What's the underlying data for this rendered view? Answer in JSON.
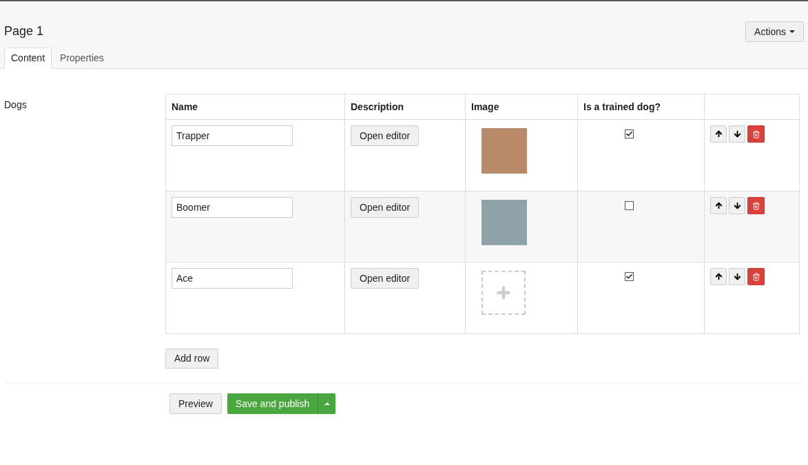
{
  "page": {
    "title": "Page 1",
    "actions_button": "Actions"
  },
  "tabs": [
    {
      "label": "Content",
      "selected": true
    },
    {
      "label": "Properties",
      "selected": false
    }
  ],
  "field": {
    "label": "Dogs"
  },
  "table": {
    "columns": [
      "Name",
      "Description",
      "Image",
      "Is a trained dog?"
    ],
    "rows": [
      {
        "name": "Trapper",
        "editor_button": "Open editor",
        "has_image": true,
        "trained": true
      },
      {
        "name": "Boomer",
        "editor_button": "Open editor",
        "has_image": true,
        "trained": false
      },
      {
        "name": "Ace",
        "editor_button": "Open editor",
        "has_image": false,
        "trained": true
      }
    ]
  },
  "add_row_button": "Add row",
  "footer": {
    "preview_button": "Preview",
    "publish_button": "Save and publish"
  }
}
